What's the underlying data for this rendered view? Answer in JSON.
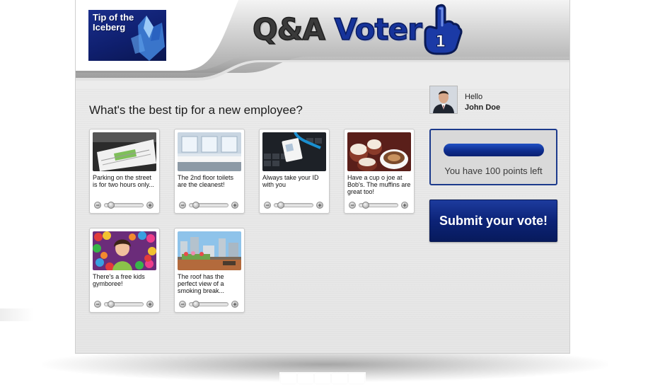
{
  "header": {
    "logo_line1": "Tip of the",
    "logo_line2": "Iceberg",
    "title_part1": "Q&A",
    "title_part2": "Voter",
    "mascot_icon": "foam-finger-number-one-icon"
  },
  "user": {
    "greeting": "Hello",
    "name": "John Doe",
    "avatar_icon": "user-portrait-photo"
  },
  "question": "What's the best tip for a new employee?",
  "points": {
    "remaining_fraction": 1.0,
    "label": "You have 100 points left"
  },
  "submit_label": "Submit your vote!",
  "cards": [
    {
      "text": "Parking on the street is for two hours only...",
      "image": "parking-ticket",
      "vote_fraction": 0.1
    },
    {
      "text": "The 2nd floor toilets are the cleanest!",
      "image": "restroom-sinks",
      "vote_fraction": 0.1
    },
    {
      "text": "Always take your ID with you",
      "image": "id-badge-keyboard",
      "vote_fraction": 0.1
    },
    {
      "text": "Have a cup o joe at Bob's. The muffins are great too!",
      "image": "coffee-and-muffins",
      "vote_fraction": 0.1
    },
    {
      "text": "There's a free kids gymboree!",
      "image": "ball-pit-child",
      "vote_fraction": 0.1
    },
    {
      "text": "The roof has the perfect view of a smoking break...",
      "image": "rooftop-city-view",
      "vote_fraction": 0.1
    }
  ],
  "colors": {
    "brand_blue": "#16339a",
    "button_blue": "#0c2377",
    "panel_gray": "#e8e8e8"
  }
}
